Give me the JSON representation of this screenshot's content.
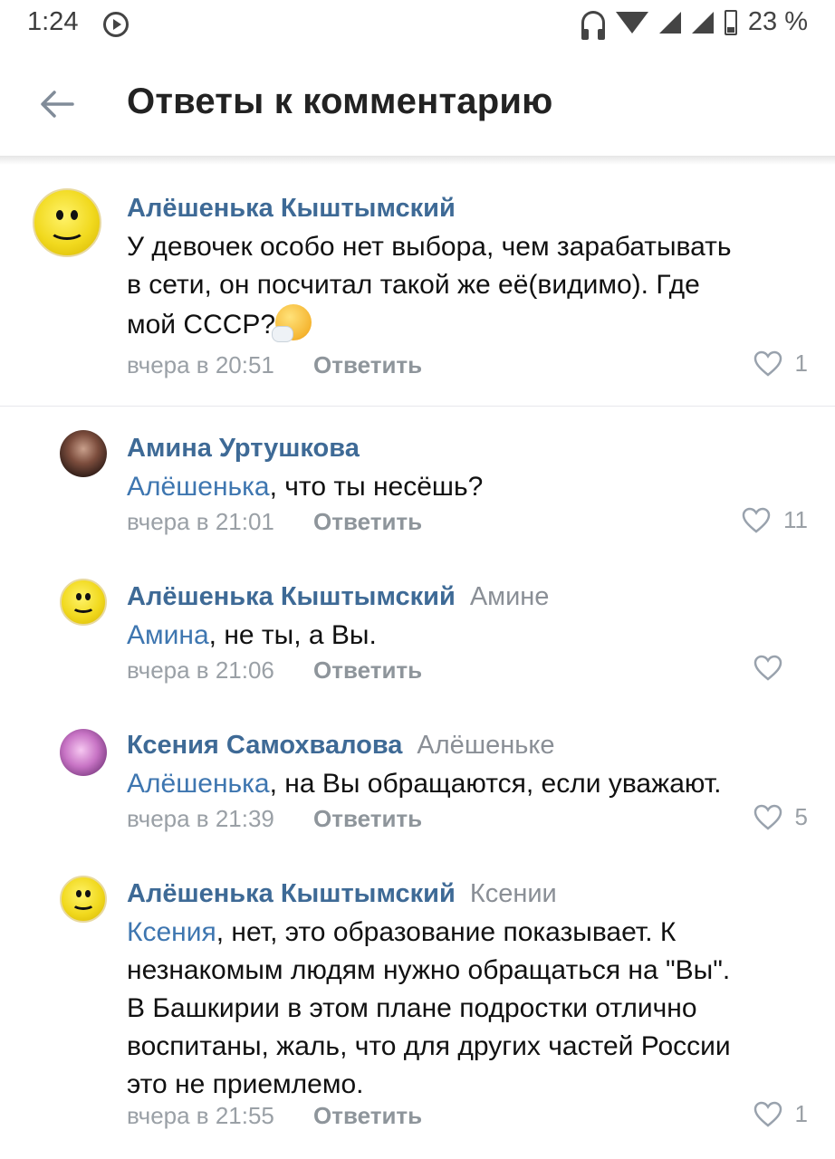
{
  "status_bar": {
    "time": "1:24",
    "battery_percent": "23 %"
  },
  "header": {
    "title": "Ответы к комментарию"
  },
  "comments": [
    {
      "author": "Алёшенька Кыштымский",
      "reply_to": "",
      "mention": "",
      "text_line1": "У девочек особо нет выбора, чем зарабатывать",
      "text_line2": "в сети, он посчитал такой же её(видимо). Где",
      "text_line3": "мой СССР?",
      "emoji": "sneezing-face-emoji",
      "date": "вчера в 20:51",
      "reply_label": "Ответить",
      "likes": "1"
    },
    {
      "author": "Амина Уртушкова",
      "reply_to": "",
      "mention": "Алёшенька",
      "text": ", что ты несёшь?",
      "date": "вчера в 21:01",
      "reply_label": "Ответить",
      "likes": "11"
    },
    {
      "author": "Алёшенька Кыштымский",
      "reply_to": "Амине",
      "mention": "Амина",
      "text": ", не ты, а Вы.",
      "date": "вчера в 21:06",
      "reply_label": "Ответить",
      "likes": ""
    },
    {
      "author": "Ксения Самохвалова",
      "reply_to": "Алёшеньке",
      "mention": "Алёшенька",
      "text": ", на Вы обращаются, если уважают.",
      "date": "вчера в 21:39",
      "reply_label": "Ответить",
      "likes": "5"
    },
    {
      "author": "Алёшенька Кыштымский",
      "reply_to": "Ксении",
      "mention": "Ксения",
      "text_line1": ", нет, это образование показывает. К",
      "text_line2": "незнакомым людям нужно обращаться на \"Вы\".",
      "text_line3": "В Башкирии в этом плане подростки отлично",
      "text_line4": "воспитаны, жаль, что для других частей России",
      "text_line5": "это не приемлемо.",
      "date": "вчера в 21:55",
      "reply_label": "Ответить",
      "likes": "1"
    }
  ],
  "colors": {
    "author": "#3e6a96",
    "mention": "#3e76b0",
    "meta": "#9aa0a6"
  }
}
